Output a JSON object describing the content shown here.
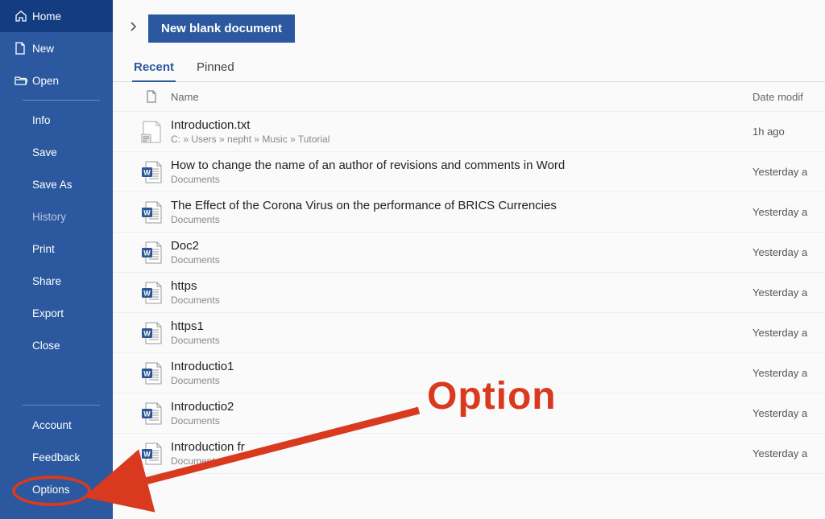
{
  "sidebar": {
    "home": "Home",
    "new": "New",
    "open": "Open",
    "info": "Info",
    "save": "Save",
    "saveas": "Save As",
    "history": "History",
    "print": "Print",
    "share": "Share",
    "export": "Export",
    "close": "Close",
    "account": "Account",
    "feedback": "Feedback",
    "options": "Options"
  },
  "top": {
    "new_blank": "New blank document"
  },
  "tabs": {
    "recent": "Recent",
    "pinned": "Pinned"
  },
  "list_header": {
    "name": "Name",
    "date": "Date modif"
  },
  "files": [
    {
      "name": "Introduction.txt",
      "path": "C: » Users » nepht » Music » Tutorial",
      "date": "1h ago",
      "type": "txt"
    },
    {
      "name": "How to change the name of an author of revisions and comments in Word",
      "path": "Documents",
      "date": "Yesterday a",
      "type": "doc"
    },
    {
      "name": "The Effect of the Corona Virus on the performance of BRICS Currencies",
      "path": "Documents",
      "date": "Yesterday a",
      "type": "doc"
    },
    {
      "name": "Doc2",
      "path": "Documents",
      "date": "Yesterday a",
      "type": "doc"
    },
    {
      "name": "https",
      "path": "Documents",
      "date": "Yesterday a",
      "type": "doc"
    },
    {
      "name": "https1",
      "path": "Documents",
      "date": "Yesterday a",
      "type": "doc"
    },
    {
      "name": "Introductio1",
      "path": "Documents",
      "date": "Yesterday a",
      "type": "doc"
    },
    {
      "name": "Introductio2",
      "path": "Documents",
      "date": "Yesterday a",
      "type": "doc"
    },
    {
      "name": "Introduction fr",
      "path": "Documents",
      "date": "Yesterday a",
      "type": "doc"
    }
  ],
  "annotation": {
    "label": "Option"
  }
}
